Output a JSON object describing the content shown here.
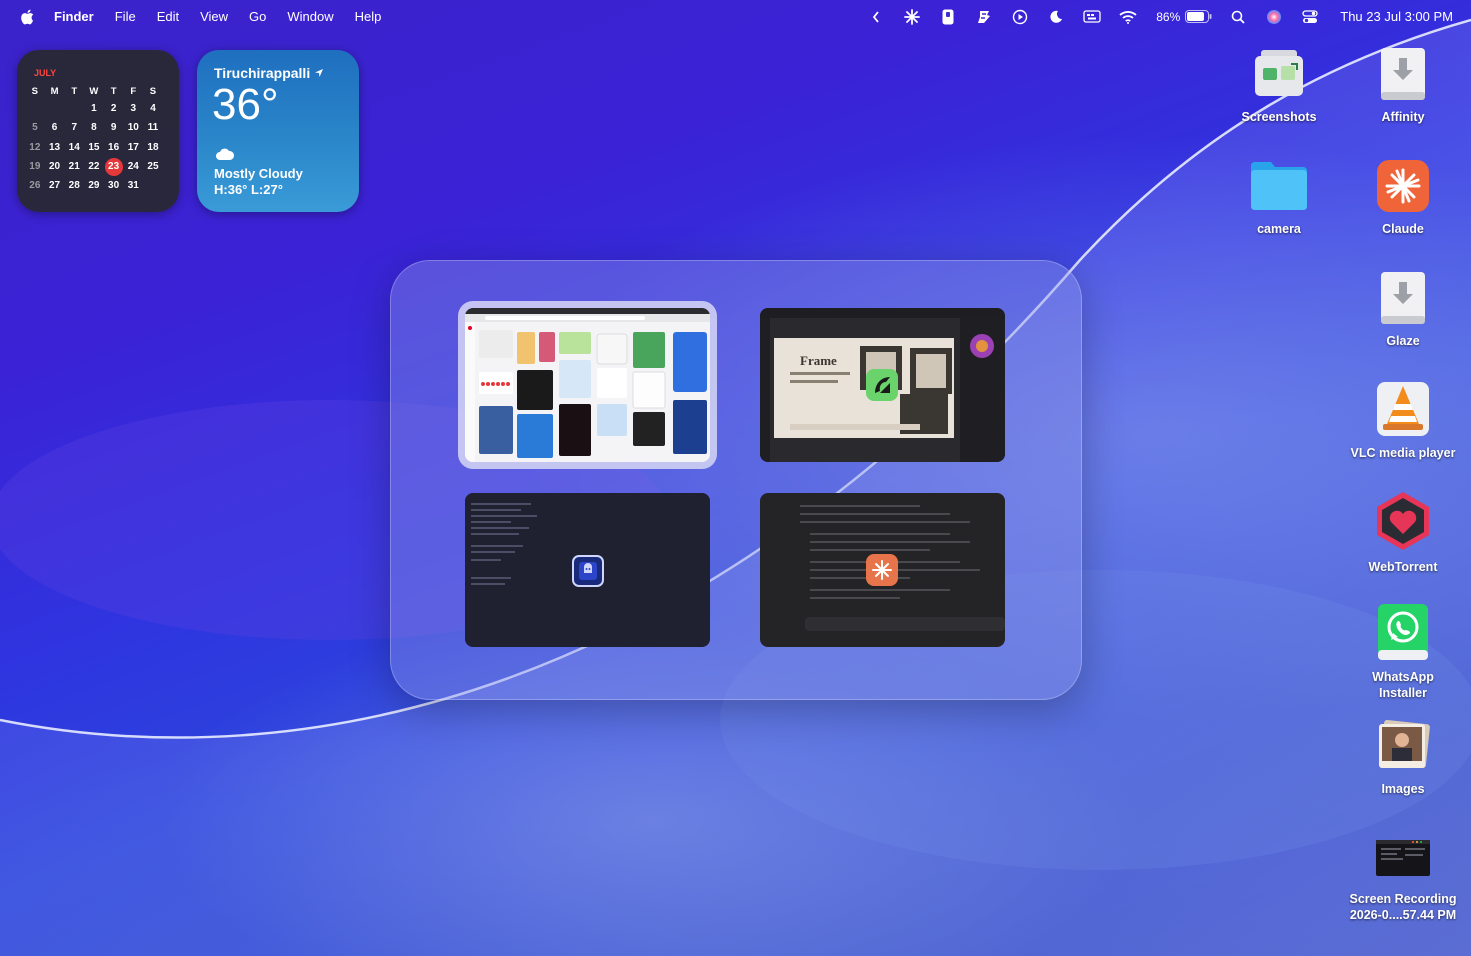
{
  "menubar": {
    "app_name": "Finder",
    "menus": [
      "File",
      "Edit",
      "View",
      "Go",
      "Window",
      "Help"
    ],
    "battery_percent": "86%",
    "clock": "Thu 23 Jul  3:00 PM",
    "status_icons": [
      "chevron-left-icon",
      "claude-icon",
      "clipboard-icon",
      "beardedspice-icon",
      "play-circle-icon",
      "moon-icon",
      "keyboard-icon",
      "wifi-icon",
      "battery-icon",
      "search-icon",
      "siri-icon",
      "control-center-icon"
    ]
  },
  "calendar_widget": {
    "month": "JULY",
    "weekdays": [
      "S",
      "M",
      "T",
      "W",
      "T",
      "F",
      "S"
    ],
    "weeks": [
      [
        "",
        "",
        "",
        "1",
        "2",
        "3",
        "4"
      ],
      [
        "5",
        "6",
        "7",
        "8",
        "9",
        "10",
        "11"
      ],
      [
        "12",
        "13",
        "14",
        "15",
        "16",
        "17",
        "18"
      ],
      [
        "19",
        "20",
        "21",
        "22",
        "23",
        "24",
        "25"
      ],
      [
        "26",
        "27",
        "28",
        "29",
        "30",
        "31",
        ""
      ]
    ],
    "today": "23"
  },
  "weather_widget": {
    "city": "Tiruchirappalli",
    "temperature": "36°",
    "condition": "Mostly Cloudy",
    "high_low": "H:36° L:27°"
  },
  "app_switcher": {
    "windows": [
      {
        "name": "browser-window",
        "app_icon": "browser-icon",
        "selected": true
      },
      {
        "name": "affinity-window",
        "app_icon": "affinity-icon",
        "selected": false,
        "visible_text": "Frame"
      },
      {
        "name": "terminal-window",
        "app_icon": "terminal-icon",
        "selected": false
      },
      {
        "name": "claude-window",
        "app_icon": "claude-icon",
        "selected": false
      }
    ]
  },
  "desktop_icons": [
    {
      "label": "Screenshots",
      "icon": "folder-screenshots-icon"
    },
    {
      "label": "Affinity",
      "icon": "installer-download-icon"
    },
    {
      "label": "camera",
      "icon": "folder-icon"
    },
    {
      "label": "Claude",
      "icon": "claude-app-icon"
    },
    {
      "label": "Glaze",
      "icon": "installer-download-icon"
    },
    {
      "label": "VLC media player",
      "icon": "vlc-icon"
    },
    {
      "label": "WebTorrent",
      "icon": "webtorrent-icon"
    },
    {
      "label": "WhatsApp\nInstaller",
      "icon": "whatsapp-icon"
    },
    {
      "label": "Images",
      "icon": "images-stack-icon"
    },
    {
      "label": "Screen Recording\n2026-0....57.44 PM",
      "icon": "video-thumbnail-icon"
    }
  ],
  "colors": {
    "accent_red": "#e5383b",
    "claude_orange": "#f0643a",
    "whatsapp_green": "#25d366",
    "folder_blue": "#3fb8f5"
  }
}
